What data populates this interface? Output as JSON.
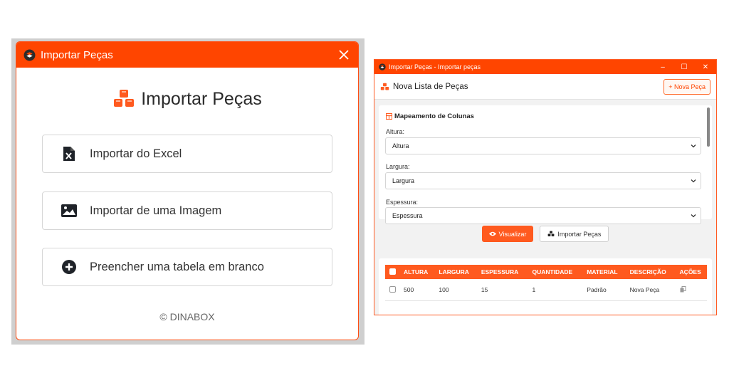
{
  "dialog": {
    "title": "Importar Peças",
    "heading": "Importar Peças",
    "options": [
      {
        "label": "Importar do Excel",
        "icon": "excel-file-icon"
      },
      {
        "label": "Importar de uma Imagem",
        "icon": "image-icon"
      },
      {
        "label": "Preencher uma tabela em branco",
        "icon": "plus-circle-icon"
      }
    ],
    "footer": "© DINABOX"
  },
  "window": {
    "title": "Importar Peças - Importar peças",
    "controls": {
      "minimize": "–",
      "maximize": "☐",
      "close": "✕"
    },
    "toolbar": {
      "title": "Nova Lista de Peças",
      "new_button": "+ Nova Peça"
    },
    "mapping": {
      "title": "Mapeamento de Colunas",
      "fields": [
        {
          "label": "Altura:",
          "value": "Altura"
        },
        {
          "label": "Largura:",
          "value": "Largura"
        },
        {
          "label": "Espessura:",
          "value": "Espessura"
        }
      ]
    },
    "buttons": {
      "preview": "Visualizar",
      "import": "Importar Peças"
    },
    "table": {
      "columns": [
        "ALTURA",
        "LARGURA",
        "ESPESSURA",
        "QUANTIDADE",
        "MATERIAL",
        "DESCRIÇÃO",
        "AÇÕES"
      ],
      "rows": [
        [
          "500",
          "100",
          "15",
          "1",
          "Padrão",
          "Nova Peça"
        ]
      ]
    }
  },
  "colors": {
    "accent": "#ff4500",
    "button": "#ff5a1f"
  }
}
